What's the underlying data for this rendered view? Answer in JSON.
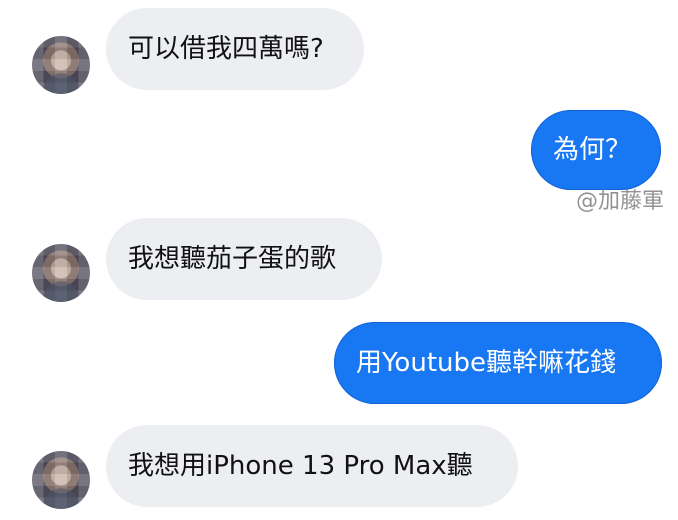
{
  "messages": [
    {
      "side": "incoming",
      "text": "可以借我四萬嗎?"
    },
    {
      "side": "outgoing",
      "text": "為何？"
    },
    {
      "side": "incoming",
      "text": "我想聽茄子蛋的歌"
    },
    {
      "side": "outgoing",
      "text": "用Youtube聽幹嘛花錢"
    },
    {
      "side": "incoming",
      "text": "我想用iPhone 13 Pro Max聽"
    }
  ],
  "watermark": {
    "text": "@加藤軍"
  },
  "colors": {
    "incoming_bubble": "#eceef1",
    "outgoing_bubble": "#1877f2"
  }
}
